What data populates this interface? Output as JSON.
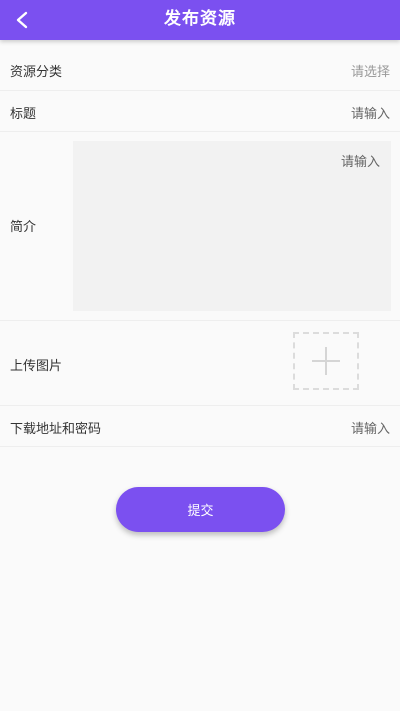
{
  "header": {
    "title": "发布资源",
    "back_icon": "chevron-left-icon",
    "color": "#7b50f0"
  },
  "form": {
    "category": {
      "label": "资源分类",
      "placeholder": "请选择"
    },
    "title": {
      "label": "标题",
      "placeholder": "请输入"
    },
    "intro": {
      "label": "简介",
      "placeholder": "请输入"
    },
    "upload": {
      "label": "上传图片",
      "icon": "plus-icon"
    },
    "download": {
      "label": "下载地址和密码",
      "placeholder": "请输入"
    }
  },
  "submit": {
    "label": "提交"
  }
}
